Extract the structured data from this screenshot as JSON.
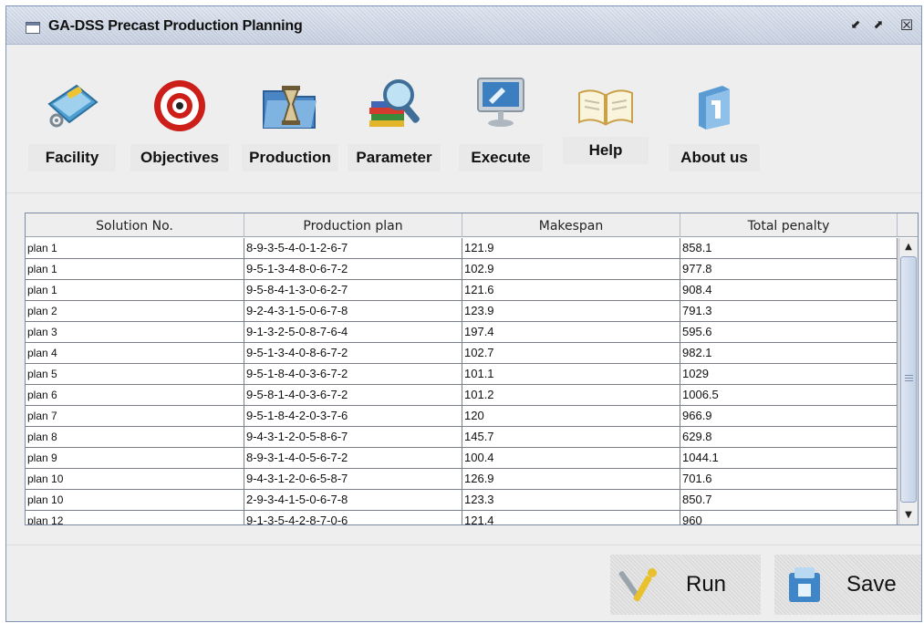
{
  "window": {
    "title": "GA-DSS Precast Production Planning",
    "controls": {
      "minimize": "⬋",
      "maximize": "⬈",
      "close": "☒"
    }
  },
  "toolbar": {
    "items": [
      {
        "label": "Facility",
        "icon": "facility-icon"
      },
      {
        "label": "Objectives",
        "icon": "target-icon"
      },
      {
        "label": "Production",
        "icon": "production-icon"
      },
      {
        "label": "Parameter",
        "icon": "parameter-icon"
      },
      {
        "label": "Execute",
        "icon": "execute-icon"
      },
      {
        "label": "Help",
        "icon": "help-book-icon"
      },
      {
        "label": "About us",
        "icon": "about-us-icon"
      }
    ]
  },
  "table": {
    "columns": [
      "Solution No.",
      "Production plan",
      "Makespan",
      "Total penalty"
    ],
    "rows": [
      [
        "plan 1",
        "8-9-3-5-4-0-1-2-6-7",
        "121.9",
        "858.1"
      ],
      [
        "plan 1",
        "9-5-1-3-4-8-0-6-7-2",
        "102.9",
        "977.8"
      ],
      [
        "plan 1",
        "9-5-8-4-1-3-0-6-2-7",
        "121.6",
        "908.4"
      ],
      [
        "plan 2",
        "9-2-4-3-1-5-0-6-7-8",
        "123.9",
        "791.3"
      ],
      [
        "plan 3",
        "9-1-3-2-5-0-8-7-6-4",
        "197.4",
        "595.6"
      ],
      [
        "plan 4",
        "9-5-1-3-4-0-8-6-7-2",
        "102.7",
        "982.1"
      ],
      [
        "plan 5",
        "9-5-1-8-4-0-3-6-7-2",
        "101.1",
        "1029"
      ],
      [
        "plan 6",
        "9-5-8-1-4-0-3-6-7-2",
        "101.2",
        "1006.5"
      ],
      [
        "plan 7",
        "9-5-1-8-4-2-0-3-7-6",
        "120",
        "966.9"
      ],
      [
        "plan 8",
        "9-4-3-1-2-0-5-8-6-7",
        "145.7",
        "629.8"
      ],
      [
        "plan 9",
        "8-9-3-1-4-0-5-6-7-2",
        "100.4",
        "1044.1"
      ],
      [
        "plan 10",
        "9-4-3-1-2-0-6-5-8-7",
        "126.9",
        "701.6"
      ],
      [
        "plan 10",
        "2-9-3-4-1-5-0-6-7-8",
        "123.3",
        "850.7"
      ],
      [
        "plan 12",
        "9-1-3-5-4-2-8-7-0-6",
        "121.4",
        "960"
      ]
    ],
    "scrollbar": {
      "up": "▲",
      "down": "▼",
      "grip": "≡"
    }
  },
  "actions": {
    "run_label": "Run",
    "save_label": "Save"
  },
  "colors": {
    "window_border": "#7e95b8",
    "panel_bg": "#eeeeee",
    "scroll_thumb": "#c4d2e7"
  }
}
